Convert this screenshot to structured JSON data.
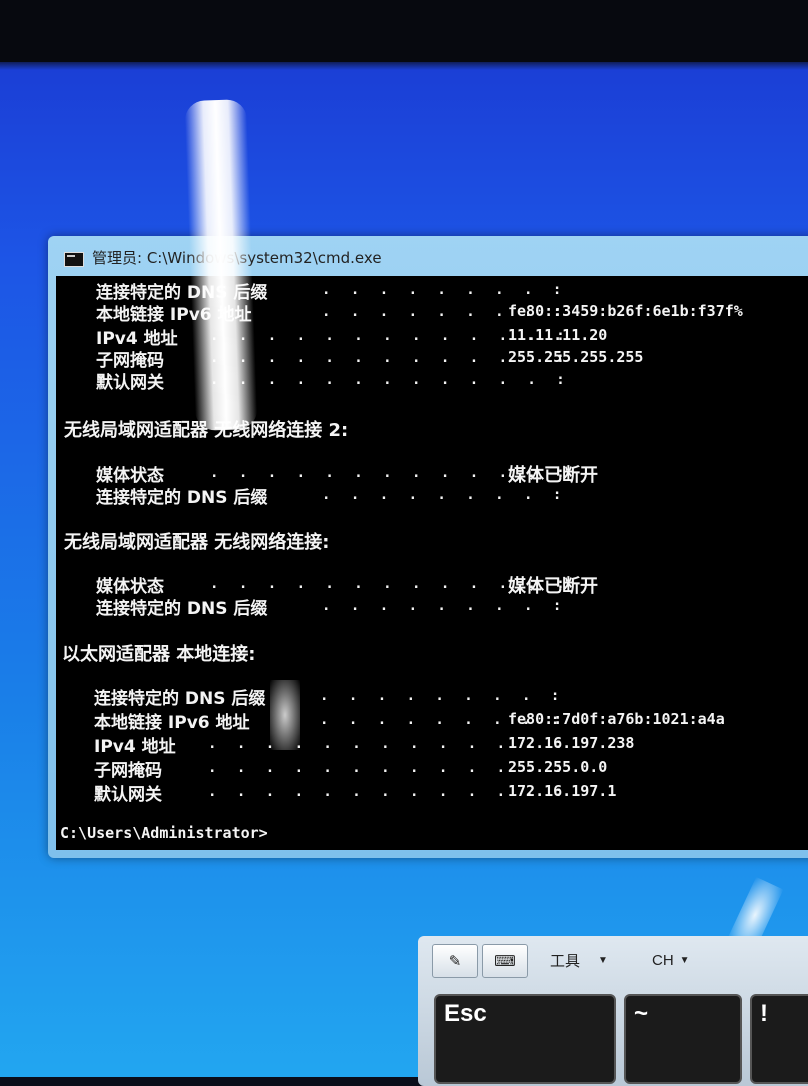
{
  "window": {
    "title": "管理员: C:\\Windows\\system32\\cmd.exe"
  },
  "console": {
    "section0": {
      "rows": [
        {
          "label": "连接特定的 DNS 后缀",
          "dots": ". . . . . . . . :",
          "value": ""
        },
        {
          "label": "本地链接 IPv6 地址",
          "dots": ". . . . . . . . :",
          "value": "fe80::3459:b26f:6e1b:f37f%"
        },
        {
          "label": "IPv4 地址",
          "dots": ". . . . . . . . . . . . :",
          "value": "11.11.11.20"
        },
        {
          "label": "子网掩码",
          "dots": ". . . . . . . . . . . . :",
          "value": "255.255.255.255"
        },
        {
          "label": "默认网关",
          "dots": ". . . . . . . . . . . . :",
          "value": ""
        }
      ]
    },
    "section1": {
      "header": "无线局域网适配器 无线网络连接 2:",
      "rows": [
        {
          "label": "媒体状态",
          "dots": ". . . . . . . . . . . . :",
          "value": "媒体已断开"
        },
        {
          "label": "连接特定的 DNS 后缀",
          "dots": ". . . . . . . . :",
          "value": ""
        }
      ]
    },
    "section2": {
      "header": "无线局域网适配器 无线网络连接:",
      "rows": [
        {
          "label": "媒体状态",
          "dots": ". . . . . . . . . . . . :",
          "value": "媒体已断开"
        },
        {
          "label": "连接特定的 DNS 后缀",
          "dots": ". . . . . . . . :",
          "value": ""
        }
      ]
    },
    "section3": {
      "header": "以太网适配器 本地连接:",
      "rows": [
        {
          "label": "连接特定的 DNS 后缀",
          "dots": ". . . . . . . . :",
          "value": ""
        },
        {
          "label": "本地链接 IPv6 地址",
          "dots": ". . . . . . . . :",
          "value": "fe80::7d0f:a76b:1021:a4a"
        },
        {
          "label": "IPv4 地址",
          "dots": ". . . . . . . . . . . . :",
          "value": "172.16.197.238"
        },
        {
          "label": "子网掩码",
          "dots": ". . . . . . . . . . . . :",
          "value": "255.255.0.0"
        },
        {
          "label": "默认网关",
          "dots": ". . . . . . . . . . . . :",
          "value": "172.16.197.1"
        }
      ]
    },
    "prompt": "C:\\Users\\Administrator>"
  },
  "osk": {
    "tools_label": "工具",
    "lang_label": "CH",
    "keys": [
      "Esc",
      "~",
      "!"
    ]
  }
}
